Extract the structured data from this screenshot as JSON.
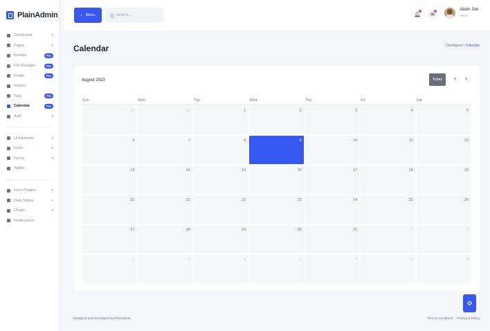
{
  "brand": {
    "name": "PlainAdmin"
  },
  "sidebar": {
    "group1": [
      {
        "label": "Dashboard",
        "icon": "dashboard-icon",
        "caret": "▾"
      },
      {
        "label": "Pages",
        "icon": "pages-icon",
        "caret": "▾"
      },
      {
        "label": "Kanban",
        "icon": "kanban-icon",
        "badge": "Pro"
      },
      {
        "label": "File Manager",
        "icon": "folder-icon",
        "badge": "Pro"
      },
      {
        "label": "Profile",
        "icon": "user-icon",
        "badge": "Pro"
      },
      {
        "label": "Invoice",
        "icon": "invoice-icon"
      },
      {
        "label": "Task",
        "icon": "task-icon",
        "badge": "Pro"
      },
      {
        "label": "Calendar",
        "icon": "calendar-icon",
        "badge": "Pro",
        "active": true
      },
      {
        "label": "Auth",
        "icon": "login-icon",
        "caret": "▾"
      }
    ],
    "group2": [
      {
        "label": "UI Elements",
        "icon": "grid-icon",
        "caret": "▾"
      },
      {
        "label": "Icons",
        "icon": "icons-icon",
        "caret": "▾"
      },
      {
        "label": "Forms",
        "icon": "forms-icon",
        "caret": "▾"
      },
      {
        "label": "Tables",
        "icon": "table-icon"
      }
    ],
    "group3": [
      {
        "label": "Form Plugins",
        "icon": "plugin-icon",
        "caret": "▾"
      },
      {
        "label": "Data Tables",
        "icon": "data-table-icon",
        "caret": "▾"
      },
      {
        "label": "Charts",
        "icon": "chart-icon",
        "caret": "▾"
      },
      {
        "label": "Notifications",
        "icon": "bell-icon"
      }
    ]
  },
  "header": {
    "menu_label": "Menu",
    "menu_chevron": "‹",
    "search_placeholder": "Search...",
    "user_name": "Adam Joe",
    "user_role": "Admin",
    "notification_dot_color": "#f04f5c"
  },
  "page": {
    "title": "Calendar",
    "breadcrumb_root": "Dashboard",
    "breadcrumb_sep": "/",
    "breadcrumb_current": "Calendar"
  },
  "calendar": {
    "month_label": "August 2023",
    "today_label": "Today",
    "prev_label": "‹",
    "next_label": "›",
    "weekdays": [
      "Sun",
      "Mon",
      "Tue",
      "Wed",
      "Thu",
      "Fri",
      "Sat"
    ],
    "weeks": [
      [
        {
          "n": "30",
          "other": true
        },
        {
          "n": "31",
          "other": true
        },
        {
          "n": "1"
        },
        {
          "n": "2"
        },
        {
          "n": "3"
        },
        {
          "n": "4"
        },
        {
          "n": "5"
        }
      ],
      [
        {
          "n": "6"
        },
        {
          "n": "7"
        },
        {
          "n": "8"
        },
        {
          "n": "9",
          "selected": true
        },
        {
          "n": "10"
        },
        {
          "n": "11"
        },
        {
          "n": "12"
        }
      ],
      [
        {
          "n": "13"
        },
        {
          "n": "14"
        },
        {
          "n": "15"
        },
        {
          "n": "16"
        },
        {
          "n": "17"
        },
        {
          "n": "18"
        },
        {
          "n": "19"
        }
      ],
      [
        {
          "n": "20"
        },
        {
          "n": "21"
        },
        {
          "n": "22"
        },
        {
          "n": "23"
        },
        {
          "n": "24"
        },
        {
          "n": "25"
        },
        {
          "n": "26"
        }
      ],
      [
        {
          "n": "27"
        },
        {
          "n": "28"
        },
        {
          "n": "29"
        },
        {
          "n": "30"
        },
        {
          "n": "31"
        },
        {
          "n": "1",
          "other": true
        },
        {
          "n": "2",
          "other": true
        }
      ],
      [
        {
          "n": "3",
          "other": true
        },
        {
          "n": "4",
          "other": true
        },
        {
          "n": "5",
          "other": true
        },
        {
          "n": "6",
          "other": true
        },
        {
          "n": "7",
          "other": true
        },
        {
          "n": "8",
          "other": true
        },
        {
          "n": "9",
          "other": true
        }
      ]
    ]
  },
  "footer": {
    "credit": "Designed and Developed by PlainAdmin",
    "terms": "Term & Conditions",
    "privacy": "Privacy & Policy"
  },
  "colors": {
    "accent": "#3657f0",
    "today_button": "#6b6e7a"
  }
}
